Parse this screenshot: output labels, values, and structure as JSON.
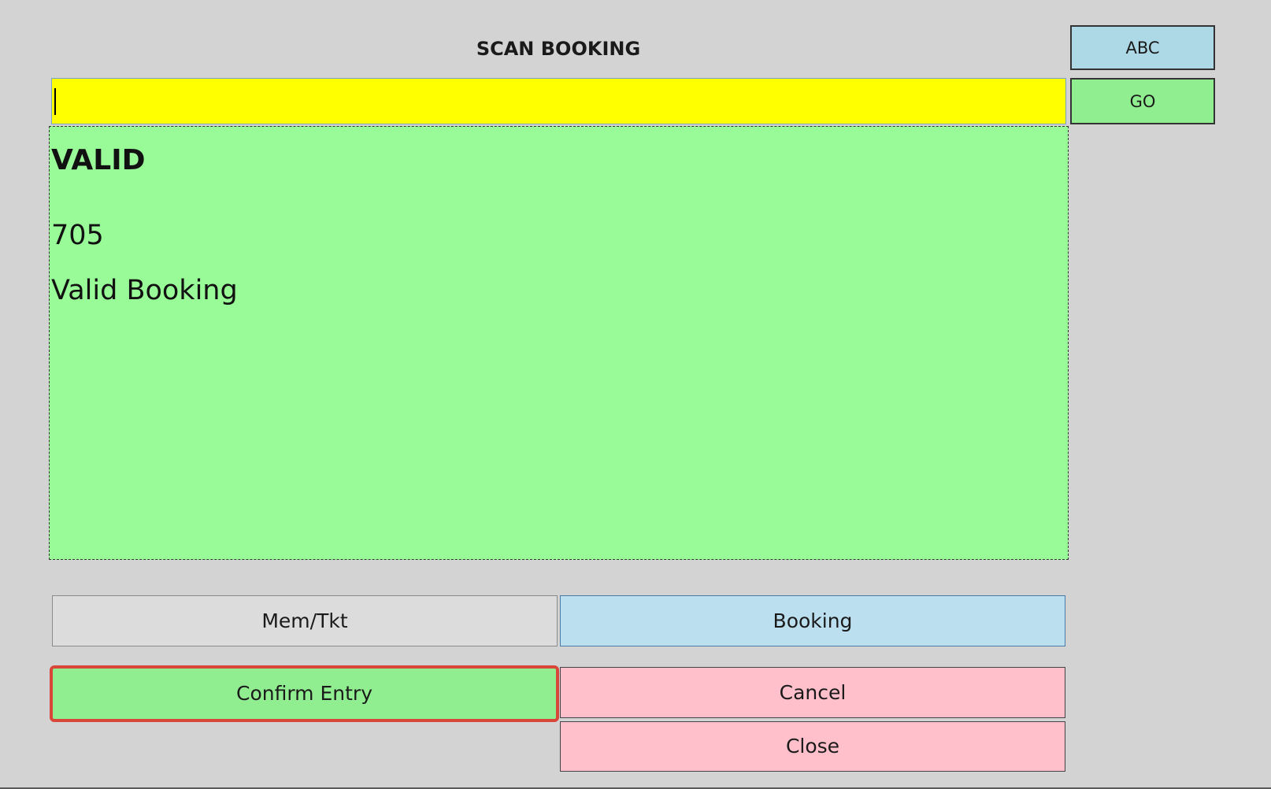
{
  "window": {
    "title": "SCAN BOOKING"
  },
  "input": {
    "value": "",
    "placeholder": ""
  },
  "side_buttons": {
    "abc_label": "ABC",
    "go_label": "GO"
  },
  "result": {
    "status": "VALID",
    "number": "705",
    "message": "Valid Booking",
    "panel_color": "#98fb98"
  },
  "mode_buttons": {
    "memtkt_label": "Mem/Tkt",
    "booking_label": "Booking"
  },
  "action_buttons": {
    "confirm_label": "Confirm Entry",
    "cancel_label": "Cancel",
    "close_label": "Close"
  },
  "colors": {
    "input_background": "#ffff00",
    "abc_button": "#add8e6",
    "go_button": "#90ee90",
    "booking_button": "#bcdff0",
    "confirm_button": "#90ee90",
    "confirm_focus_border": "#d9473a",
    "cancel_close_button": "#ffc0cb"
  }
}
